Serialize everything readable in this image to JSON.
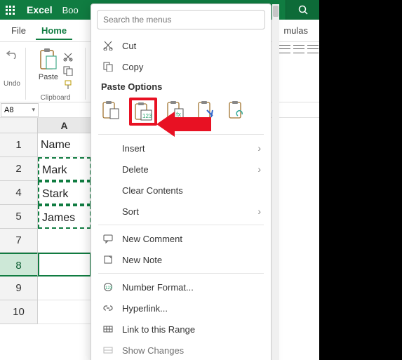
{
  "title": {
    "app": "Excel",
    "doc": "Boo"
  },
  "tabs": {
    "file": "File",
    "home": "Home",
    "formulas": "mulas"
  },
  "ribbon": {
    "undo_label": "Undo",
    "paste_label": "Paste",
    "clipboard_label": "Clipboard"
  },
  "namebox": {
    "ref": "A8"
  },
  "columns": {
    "A": "A"
  },
  "rows": {
    "r1": {
      "num": "1",
      "A": "Name"
    },
    "r2": {
      "num": "2",
      "A": "Mark"
    },
    "r4": {
      "num": "4",
      "A": "Stark"
    },
    "r5": {
      "num": "5",
      "A": "James"
    },
    "r7": {
      "num": "7",
      "A": ""
    },
    "r8": {
      "num": "8",
      "A": ""
    },
    "r9": {
      "num": "9",
      "A": ""
    },
    "r10": {
      "num": "10",
      "A": ""
    }
  },
  "ctx": {
    "search_placeholder": "Search the menus",
    "cut": "Cut",
    "copy": "Copy",
    "paste_heading": "Paste Options",
    "insert": "Insert",
    "delete": "Delete",
    "clear": "Clear Contents",
    "sort": "Sort",
    "new_comment": "New Comment",
    "new_note": "New Note",
    "number_format": "Number Format...",
    "hyperlink": "Hyperlink...",
    "link_range": "Link to this Range",
    "show_changes": "Show Changes"
  }
}
